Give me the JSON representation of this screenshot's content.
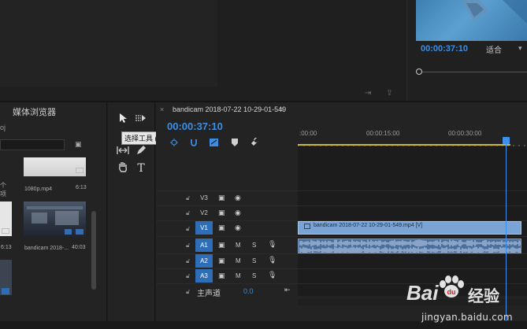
{
  "program_monitor": {
    "timecode": "00:00:37:10",
    "fit_value": "适合",
    "fit_arrow": "▾"
  },
  "source_bottom_icons": "⇥ ⇪",
  "project_panel": {
    "tab_label": "媒体浏览器",
    "path_fragment": "oj",
    "search_value": "",
    "find_icon": "▣",
    "items": [
      {
        "label": "1080p.mp4",
        "duration": "6:13"
      },
      {
        "label": "bandicam 2018-...",
        "duration": "40:03"
      }
    ],
    "left_fragment_1": "个项",
    "left_fragment_dur": "6:13"
  },
  "tools": {
    "tooltip": "选择工具 (V)"
  },
  "timeline": {
    "sequence_name": "bandicam 2018-07-22 10-29-01-549",
    "close_glyph": "×",
    "menu_glyph": "≡",
    "timecode": "00:00:37:10",
    "ruler_times": [
      ":00:00",
      "00:00:15:00",
      "00:00:30:00"
    ],
    "tracks": [
      {
        "id": "V3",
        "target": "",
        "type": "video"
      },
      {
        "id": "V2",
        "target": "",
        "type": "video"
      },
      {
        "id": "V1",
        "target": "V1",
        "type": "video"
      },
      {
        "id": "A1",
        "target": "A1",
        "type": "audio"
      },
      {
        "id": "A2",
        "target": "A2",
        "type": "audio"
      },
      {
        "id": "A3",
        "target": "A3",
        "type": "audio"
      }
    ],
    "mute_label": "M",
    "solo_label": "S",
    "video_clip_label": "bandicam 2018-07-22 10-29-01-549.mp4 [V]",
    "master_label": "主声道",
    "master_value": "0.0",
    "master_end_icon": "⇤"
  },
  "watermark": {
    "bai": "Bai",
    "du": "经验",
    "url": "jingyan.baidu.com"
  },
  "colors": {
    "accent_blue": "#3a8ee6",
    "track_target_blue": "#2e6db8",
    "video_clip": "#7aa4d6",
    "audio_clip": "#4b6f9d",
    "work_area": "#c9b53a"
  }
}
